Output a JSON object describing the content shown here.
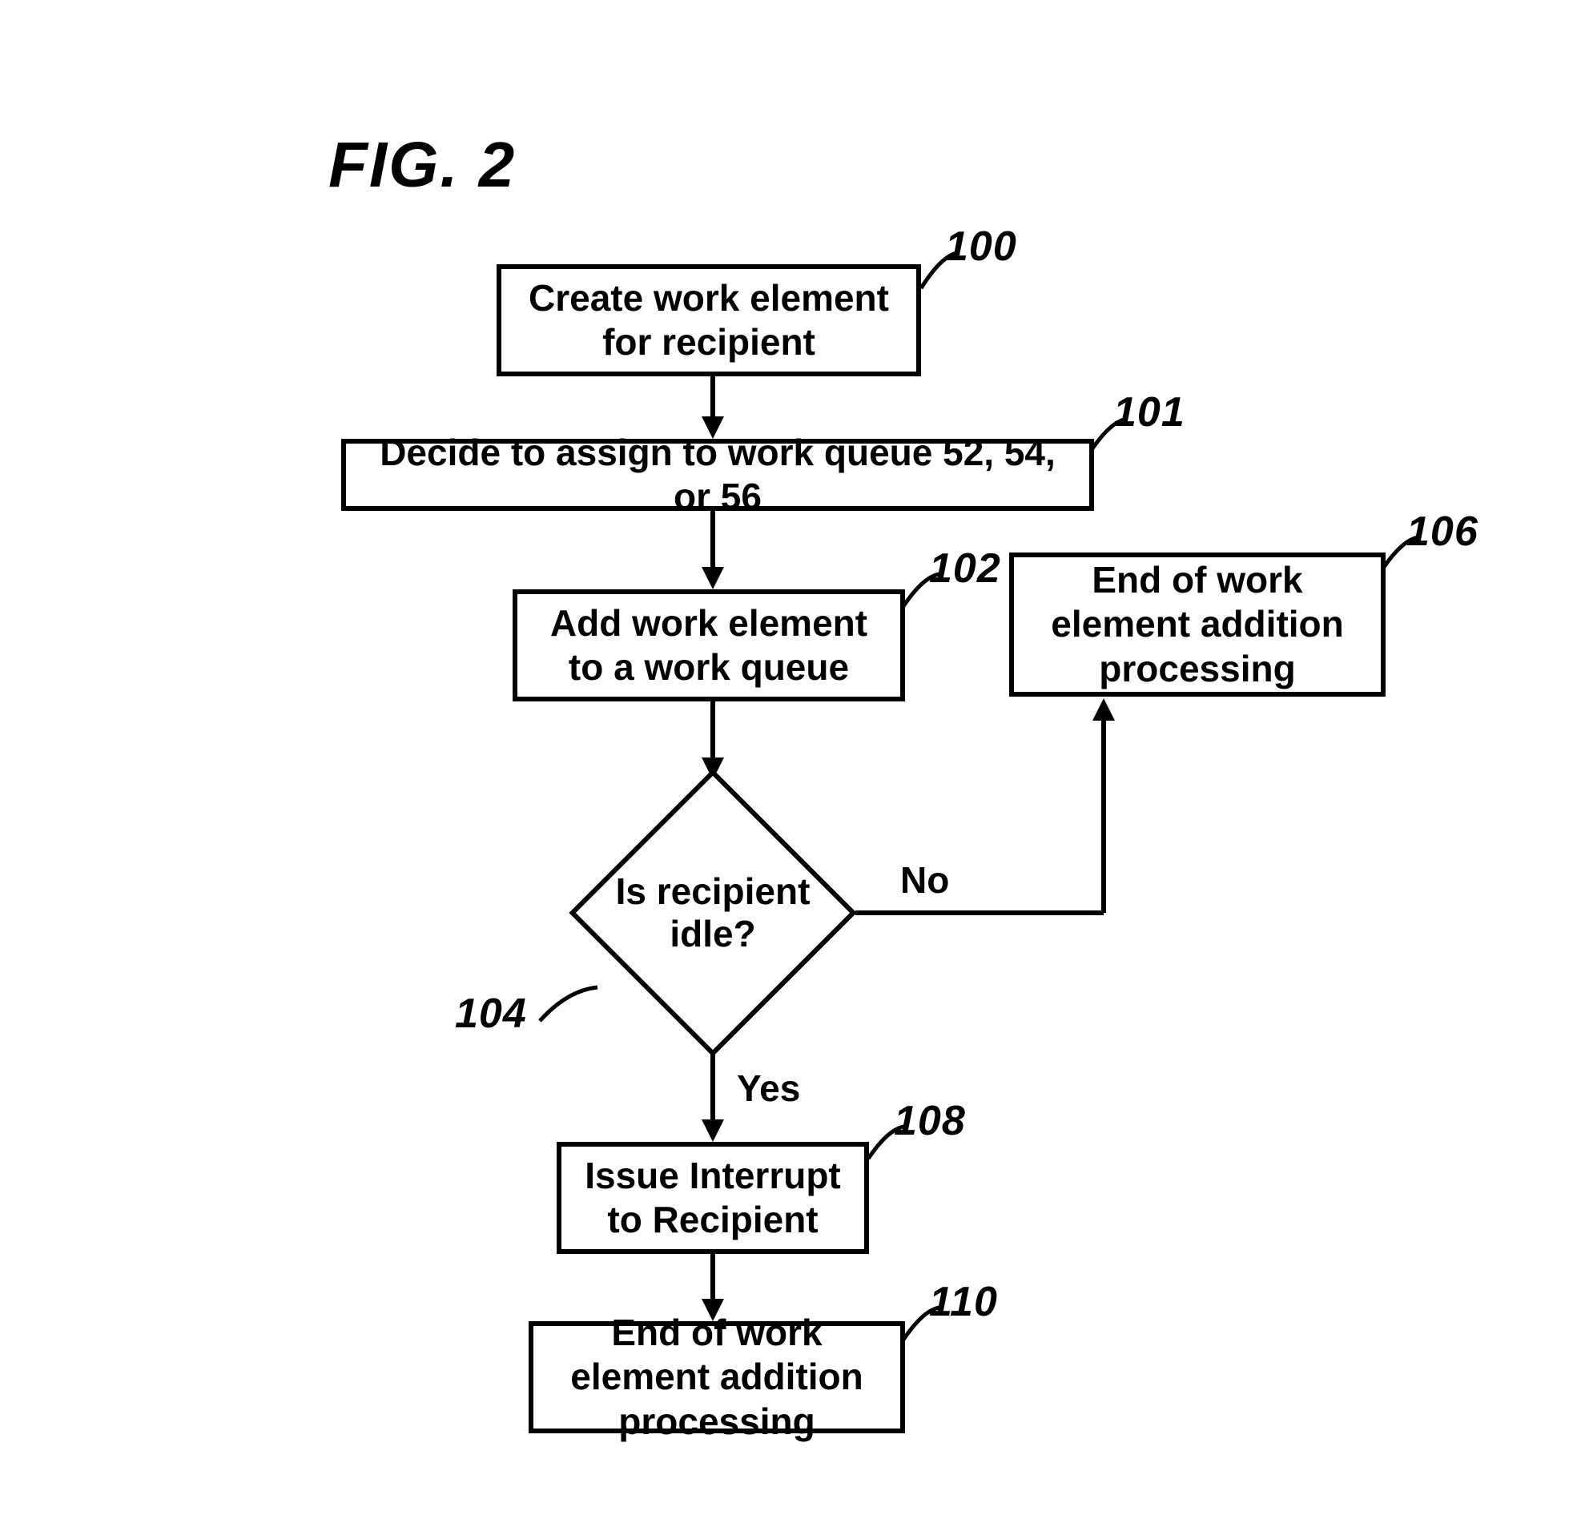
{
  "figure": {
    "title": "FIG. 2"
  },
  "nodes": {
    "n100": {
      "text": "Create work element for recipient",
      "ref": "100"
    },
    "n101": {
      "text": "Decide to assign to work queue 52, 54, or 56",
      "ref": "101"
    },
    "n102": {
      "text": "Add work element to a work queue",
      "ref": "102"
    },
    "n104": {
      "text": "Is recipient idle?",
      "ref": "104"
    },
    "n106": {
      "text": "End of work element addition processing",
      "ref": "106"
    },
    "n108": {
      "text": "Issue Interrupt to Recipient",
      "ref": "108"
    },
    "n110": {
      "text": "End of work element addition processing",
      "ref": "110"
    }
  },
  "edges": {
    "yes": "Yes",
    "no": "No"
  }
}
